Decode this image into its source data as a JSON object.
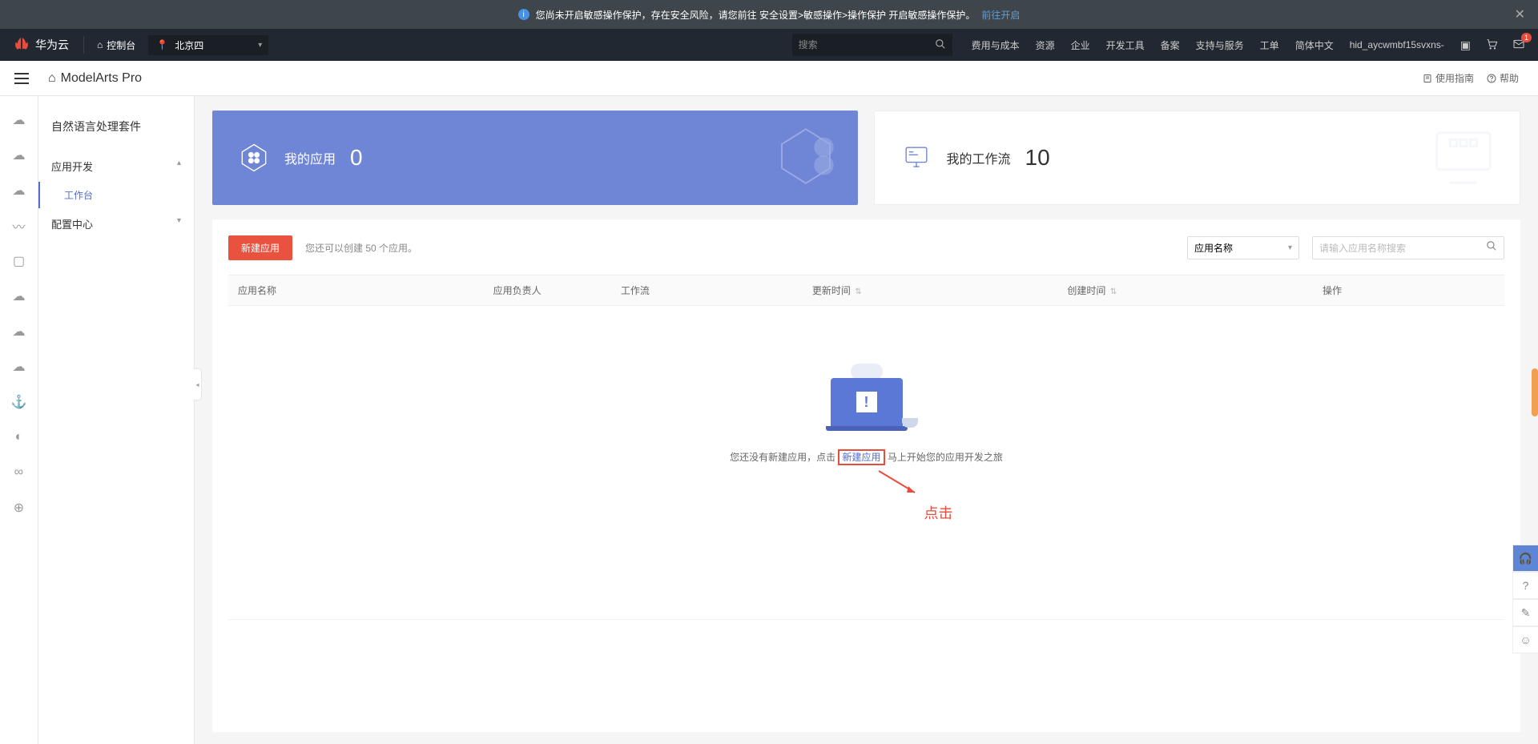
{
  "alert": {
    "text": "您尚未开启敏感操作保护，存在安全风险，请您前往 安全设置>敏感操作>操作保护 开启敏感操作保护。",
    "link": "前往开启"
  },
  "topnav": {
    "brand": "华为云",
    "console": "控制台",
    "region": "北京四",
    "search_placeholder": "搜索",
    "links": [
      "费用与成本",
      "资源",
      "企业",
      "开发工具",
      "备案",
      "支持与服务",
      "工单",
      "简体中文"
    ],
    "user": "hid_aycwmbf15svxns-",
    "badge": "1"
  },
  "subheader": {
    "title": "ModelArts Pro",
    "guide": "使用指南",
    "help": "帮助"
  },
  "sidebar": {
    "title": "自然语言处理套件",
    "section1": "应用开发",
    "item1": "工作台",
    "section2": "配置中心"
  },
  "stats": {
    "apps_label": "我的应用",
    "apps_count": "0",
    "flows_label": "我的工作流",
    "flows_count": "10"
  },
  "panel": {
    "new_btn": "新建应用",
    "hint": "您还可以创建 50 个应用。",
    "filter_select": "应用名称",
    "search_placeholder": "请输入应用名称搜索",
    "cols": {
      "name": "应用名称",
      "owner": "应用负责人",
      "flow": "工作流",
      "updated": "更新时间",
      "created": "创建时间",
      "ops": "操作"
    },
    "empty_pre": "您还没有新建应用，点击",
    "empty_link": "新建应用",
    "empty_post": "马上开始您的应用开发之旅"
  },
  "annotation": {
    "label": "点击"
  }
}
